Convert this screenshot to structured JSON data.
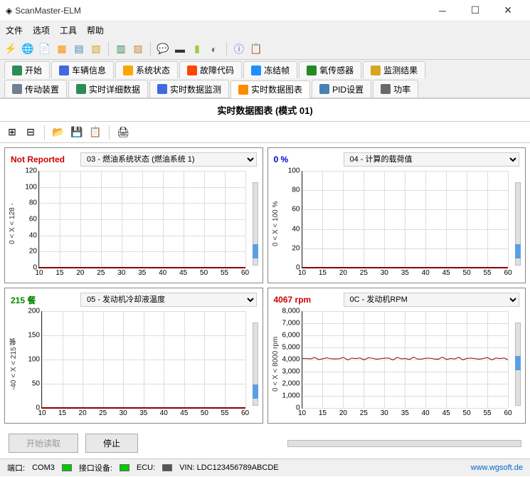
{
  "window": {
    "title": "ScanMaster-ELM"
  },
  "menu": {
    "file": "文件",
    "options": "选项",
    "tools": "工具",
    "help": "帮助"
  },
  "tabs": {
    "row1": [
      {
        "label": "开始",
        "icon": "#2e8b57"
      },
      {
        "label": "车辆信息",
        "icon": "#4169e1"
      },
      {
        "label": "系统状态",
        "icon": "#ffa500"
      },
      {
        "label": "故障代码",
        "icon": "#ff4500"
      },
      {
        "label": "冻结帧",
        "icon": "#1e90ff"
      },
      {
        "label": "氧传感器",
        "icon": "#228b22"
      },
      {
        "label": "监测结果",
        "icon": "#daa520"
      }
    ],
    "row2": [
      {
        "label": "传动装置",
        "icon": "#708090"
      },
      {
        "label": "实时详细数据",
        "icon": "#2e8b57"
      },
      {
        "label": "实时数据监测",
        "icon": "#4169e1"
      },
      {
        "label": "实时数据图表",
        "icon": "#ff8c00",
        "active": true
      },
      {
        "label": "PID设置",
        "icon": "#4682b4"
      },
      {
        "label": "功率",
        "icon": "#696969"
      }
    ]
  },
  "panel_title": "实时数据图表 (模式 01)",
  "chart_data": [
    {
      "value_label": "Not Reported",
      "value_color": "#cc0000",
      "select": "03 - 燃油系统状态 (燃油系统 1)",
      "ylabel": "0  < X <  128  -",
      "yticks": [
        "0",
        "20",
        "40",
        "60",
        "80",
        "100",
        "120"
      ],
      "xticks": [
        "10",
        "15",
        "20",
        "25",
        "30",
        "35",
        "40",
        "45",
        "50",
        "55",
        "60"
      ],
      "ylim": [
        0,
        128
      ],
      "line_y_percent": 99,
      "type": "line"
    },
    {
      "value_label": "0 %",
      "value_color": "#0000cc",
      "select": "04 - 计算的载荷值",
      "ylabel": "0  < X <  100  %",
      "yticks": [
        "0",
        "20",
        "40",
        "60",
        "80",
        "100"
      ],
      "xticks": [
        "10",
        "15",
        "20",
        "25",
        "30",
        "35",
        "40",
        "45",
        "50",
        "55",
        "60"
      ],
      "ylim": [
        0,
        100
      ],
      "line_y_percent": 99,
      "type": "line"
    },
    {
      "value_label": "215 餐",
      "value_color": "#008800",
      "select": "05 - 发动机冷却液温度",
      "ylabel": "-40  < X <  215  餐",
      "yticks": [
        "0",
        "50",
        "100",
        "150",
        "200"
      ],
      "xticks": [
        "10",
        "15",
        "20",
        "25",
        "30",
        "35",
        "40",
        "45",
        "50",
        "55",
        "60"
      ],
      "ylim": [
        -40,
        215
      ],
      "line_y_percent": 99,
      "type": "line"
    },
    {
      "value_label": "4067 rpm",
      "value_color": "#cc0000",
      "select": "0C - 发动机RPM",
      "ylabel": "0  < X <  8000  rpm",
      "yticks": [
        "0",
        "1,000",
        "2,000",
        "3,000",
        "4,000",
        "5,000",
        "6,000",
        "7,000",
        "8,000"
      ],
      "xticks": [
        "10",
        "15",
        "20",
        "25",
        "30",
        "35",
        "40",
        "45",
        "50",
        "55",
        "60"
      ],
      "ylim": [
        0,
        8000
      ],
      "line_y_percent": 49,
      "noisy": true,
      "type": "line"
    }
  ],
  "buttons": {
    "start": "开始读取",
    "stop": "停止"
  },
  "status": {
    "port_label": "端口:",
    "port_value": "COM3",
    "iface_label": "接口设备:",
    "ecu_label": "ECU:",
    "vin_label": "VIN: LDC123456789ABCDE",
    "url": "www.wgsoft.de"
  }
}
